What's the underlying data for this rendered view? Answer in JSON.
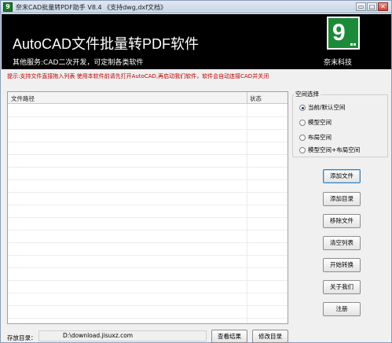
{
  "window": {
    "title": "奈末CAD批量转PDF助手 V8.4 《支持dwg,dxf文档》",
    "app_icon_glyph": "9",
    "controls": {
      "minimize": "▭",
      "maximize": "□",
      "close": "✕"
    }
  },
  "banner": {
    "title": "AutoCAD文件批量转PDF软件",
    "subtitle": "其他服务:CAD二次开发，可定制各类软件",
    "logo_mark": "9",
    "company": "奈末科技",
    "logo_color": "#1d8a3a"
  },
  "hint": "提示:支持文件直接拖入列表  使用本软件前请先打开AutoCAD,再启动我们软件，软件会自动连接CAD并关闭",
  "file_table": {
    "columns": [
      "文件路径",
      "状态"
    ],
    "rows": []
  },
  "space_group": {
    "legend": "空间选择",
    "options": [
      "当前/默认空间",
      "模型空间",
      "布局空间",
      "模型空间+布局空间"
    ],
    "selected": "当前/默认空间"
  },
  "buttons": {
    "add_file": "添加文件",
    "add_dir": "添加目录",
    "remove_file": "移除文件",
    "clear_list": "清空列表",
    "start_convert": "开始转换",
    "about": "关于我们",
    "register": "注册"
  },
  "footer": {
    "save_label": "存放目录：",
    "save_path": "D:\\download.jisuxz.com",
    "view_result": "查看结果",
    "modify_dir": "修改目录"
  }
}
